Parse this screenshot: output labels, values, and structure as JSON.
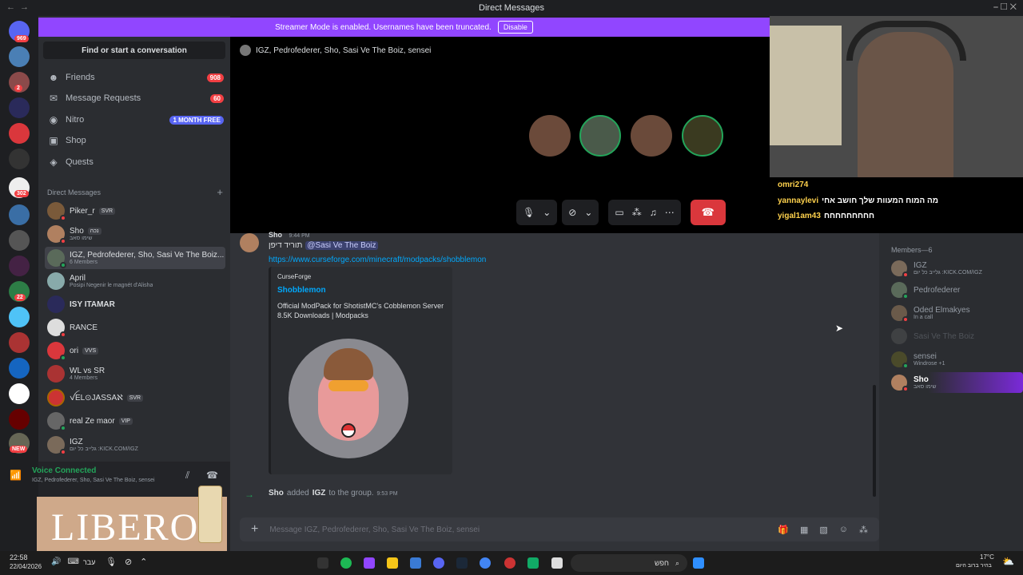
{
  "window": {
    "title": "Direct Messages"
  },
  "streamer_banner": {
    "text": "Streamer Mode is enabled. Usernames have been truncated.",
    "button": "Disable"
  },
  "servers": {
    "badges": [
      "969",
      "2",
      "1",
      "302",
      "1",
      "22",
      "1"
    ],
    "new_label": "NEW"
  },
  "search": {
    "label": "Find or start a conversation"
  },
  "nav": [
    {
      "label": "Friends",
      "badge": "908"
    },
    {
      "label": "Message Requests",
      "badge": "60"
    },
    {
      "label": "Nitro",
      "badge": "1 MONTH FREE"
    },
    {
      "label": "Shop",
      "badge": ""
    },
    {
      "label": "Quests",
      "badge": ""
    }
  ],
  "dm_header": {
    "label": "Direct Messages",
    "add": "+"
  },
  "dms": [
    {
      "name": "Piker_r",
      "tag": "SVR",
      "sub": ""
    },
    {
      "name": "Sho",
      "tag": "נכה",
      "sub": "שימו סאב"
    },
    {
      "name": "IGZ, Pedrofederer, Sho, Sasi Ve The Boiz...",
      "tag": "",
      "sub": "6 Members"
    },
    {
      "name": "April",
      "tag": "",
      "sub": "Posipi Negenir le magnét d'Alisha"
    },
    {
      "name": "ISY ITAMAR",
      "tag": "",
      "sub": ""
    },
    {
      "name": "RANCE",
      "tag": "",
      "sub": ""
    },
    {
      "name": "ori",
      "tag": "VVS",
      "sub": ""
    },
    {
      "name": "WL vs SR",
      "tag": "",
      "sub": "4 Members"
    },
    {
      "name": "ꪜEL⊙JASSAℵ",
      "tag": "SVR",
      "sub": ""
    },
    {
      "name": "real Ze maor",
      "tag": "VIP",
      "sub": ""
    },
    {
      "name": "IGZ",
      "tag": "",
      "sub": "גלייב כל יום :KICK.COM/IGZ"
    }
  ],
  "voice": {
    "status": "Voice Connected",
    "channel": "IGZ, Pedrofederer, Sho, Sasi Ve The Boiz, sensei"
  },
  "overlay": {
    "brand": "LIBERO"
  },
  "call": {
    "title": "IGZ, Pedrofederer, Sho, Sasi Ve The Boiz, sensei"
  },
  "stream_chat": [
    {
      "user": "omri274",
      "msg": ""
    },
    {
      "user": "yannaylevi",
      "msg": "מה המוח המעוות שלך חושב אחי"
    },
    {
      "user": "yigal1am43",
      "msg": "חחחחחחחחח"
    }
  ],
  "message": {
    "author": "Sho",
    "time": "9:44 PM",
    "text_prefix": "תוריד דיפן",
    "mention": "@Sasi Ve The Boiz",
    "link": "https://www.curseforge.com/minecraft/modpacks/shobblemon",
    "embed": {
      "provider": "CurseForge",
      "title": "Shobblemon",
      "description": "Official ModPack for ShotistMC's Cobblemon Server",
      "meta": "8.5K Downloads | Modpacks"
    }
  },
  "system_msg": {
    "actor": "Sho",
    "verb": "added",
    "target": "IGZ",
    "rest": "to the group.",
    "time": "9:53 PM"
  },
  "composer": {
    "placeholder": "Message IGZ, Pedrofederer, Sho, Sasi Ve The Boiz, sensei"
  },
  "members": {
    "header": "Members—6",
    "list": [
      {
        "name": "IGZ",
        "sub": "גלייב כל יום :KICK.COM/IGZ"
      },
      {
        "name": "Pedrofederer",
        "sub": ""
      },
      {
        "name": "Oded Elmakyes",
        "sub": "In a call"
      },
      {
        "name": "Sasi Ve The Boiz",
        "sub": ""
      },
      {
        "name": "sensei",
        "sub": "Windrose +1"
      },
      {
        "name": "Sho",
        "sub": "שימו סאב"
      }
    ]
  },
  "taskbar": {
    "time": "22:58",
    "date": "22/04/2026",
    "lang": "עבר",
    "search": "חפש",
    "weather_temp": "17°C",
    "weather_desc": "בהיר ברוב היום"
  },
  "colors": {
    "accent": "#5865f2",
    "streamer": "#9146ff",
    "hangup": "#da373c",
    "online": "#23a55a"
  }
}
